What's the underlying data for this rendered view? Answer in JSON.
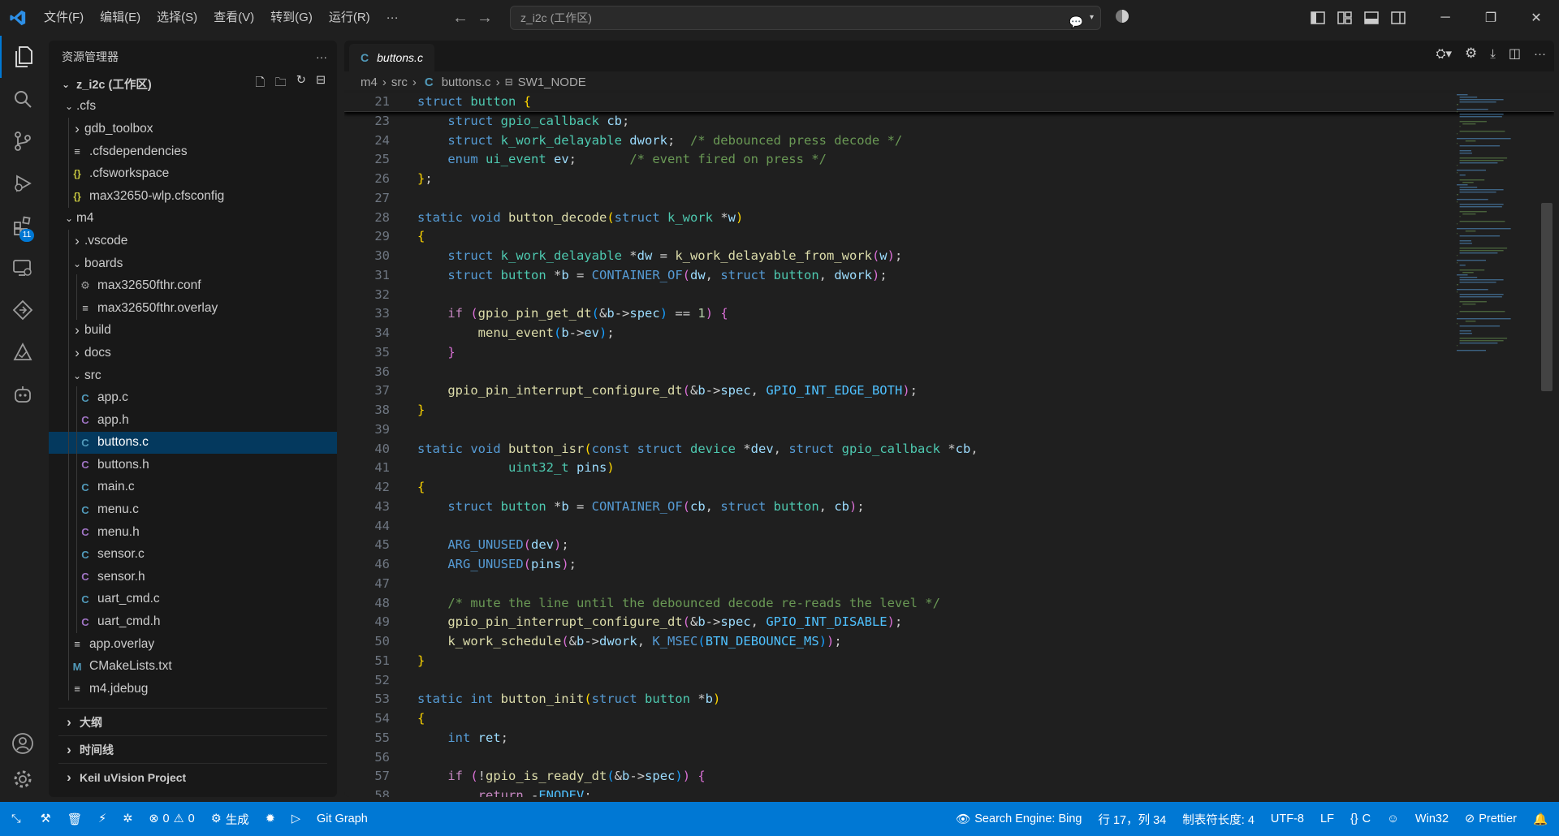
{
  "titlebar": {
    "menus": [
      "文件(F)",
      "编辑(E)",
      "选择(S)",
      "查看(V)",
      "转到(G)",
      "运行(R)",
      "···"
    ],
    "command_center": "z_i2c (工作区)"
  },
  "activity": {
    "extensions_badge": "11"
  },
  "explorer": {
    "title": "资源管理器",
    "more": "···",
    "workspace": "z_i2c (工作区)",
    "rows": [
      {
        "label": ".cfs",
        "depth": 1,
        "chev": "down",
        "icon": ""
      },
      {
        "label": "gdb_toolbox",
        "depth": 2,
        "chev": "right",
        "icon": ""
      },
      {
        "label": ".cfsdependencies",
        "depth": 2,
        "chev": "",
        "icon": "≡"
      },
      {
        "label": ".cfsworkspace",
        "depth": 2,
        "chev": "",
        "icon": "{}"
      },
      {
        "label": "max32650-wlp.cfsconfig",
        "depth": 2,
        "chev": "",
        "icon": "{}"
      },
      {
        "label": "m4",
        "depth": 1,
        "chev": "down",
        "icon": ""
      },
      {
        "label": ".vscode",
        "depth": 2,
        "chev": "right",
        "icon": ""
      },
      {
        "label": "boards",
        "depth": 2,
        "chev": "down",
        "icon": ""
      },
      {
        "label": "max32650fthr.conf",
        "depth": 3,
        "chev": "",
        "icon": "⚙"
      },
      {
        "label": "max32650fthr.overlay",
        "depth": 3,
        "chev": "",
        "icon": "≡"
      },
      {
        "label": "build",
        "depth": 2,
        "chev": "right",
        "icon": ""
      },
      {
        "label": "docs",
        "depth": 2,
        "chev": "right",
        "icon": ""
      },
      {
        "label": "src",
        "depth": 2,
        "chev": "down",
        "icon": ""
      },
      {
        "label": "app.c",
        "depth": 3,
        "chev": "",
        "icon": "C"
      },
      {
        "label": "app.h",
        "depth": 3,
        "chev": "",
        "icon": "C"
      },
      {
        "label": "buttons.c",
        "depth": 3,
        "chev": "",
        "icon": "C"
      },
      {
        "label": "buttons.h",
        "depth": 3,
        "chev": "",
        "icon": "C"
      },
      {
        "label": "main.c",
        "depth": 3,
        "chev": "",
        "icon": "C"
      },
      {
        "label": "menu.c",
        "depth": 3,
        "chev": "",
        "icon": "C"
      },
      {
        "label": "menu.h",
        "depth": 3,
        "chev": "",
        "icon": "C"
      },
      {
        "label": "sensor.c",
        "depth": 3,
        "chev": "",
        "icon": "C"
      },
      {
        "label": "sensor.h",
        "depth": 3,
        "chev": "",
        "icon": "C"
      },
      {
        "label": "uart_cmd.c",
        "depth": 3,
        "chev": "",
        "icon": "C"
      },
      {
        "label": "uart_cmd.h",
        "depth": 3,
        "chev": "",
        "icon": "C"
      },
      {
        "label": "app.overlay",
        "depth": 2,
        "chev": "",
        "icon": "≡"
      },
      {
        "label": "CMakeLists.txt",
        "depth": 2,
        "chev": "",
        "icon": "M"
      },
      {
        "label": "m4.jdebug",
        "depth": 2,
        "chev": "",
        "icon": "≡"
      }
    ],
    "selected": "buttons.c",
    "sections": [
      "大纲",
      "时间线",
      "Keil uVision Project"
    ]
  },
  "editor": {
    "tab": "buttons.c",
    "breadcrumb": [
      "m4",
      "src",
      "buttons.c",
      "SW1_NODE"
    ],
    "lines": [
      {
        "n": "21",
        "sticky": true,
        "t": [
          [
            "kw",
            "struct "
          ],
          [
            "ty",
            "button "
          ],
          [
            "b1",
            "{"
          ]
        ]
      },
      {
        "n": "23",
        "t": [
          [
            "",
            "    "
          ],
          [
            "kw",
            "struct "
          ],
          [
            "ty",
            "gpio_callback "
          ],
          [
            "va",
            "cb"
          ],
          [
            "",
            ";"
          ]
        ]
      },
      {
        "n": "24",
        "t": [
          [
            "",
            "    "
          ],
          [
            "kw",
            "struct "
          ],
          [
            "ty",
            "k_work_delayable "
          ],
          [
            "va",
            "dwork"
          ],
          [
            "",
            ";  "
          ],
          [
            "cm",
            "/* debounced press decode */"
          ]
        ]
      },
      {
        "n": "25",
        "t": [
          [
            "",
            "    "
          ],
          [
            "kw",
            "enum "
          ],
          [
            "ty",
            "ui_event "
          ],
          [
            "va",
            "ev"
          ],
          [
            "",
            ";       "
          ],
          [
            "cm",
            "/* event fired on press */"
          ]
        ]
      },
      {
        "n": "26",
        "t": [
          [
            "b1",
            "}"
          ],
          [
            "",
            ";"
          ]
        ]
      },
      {
        "n": "27",
        "t": []
      },
      {
        "n": "28",
        "t": [
          [
            "kw",
            "static void "
          ],
          [
            "fn",
            "button_decode"
          ],
          [
            "b1",
            "("
          ],
          [
            "kw",
            "struct "
          ],
          [
            "ty",
            "k_work "
          ],
          [
            "",
            "*"
          ],
          [
            "va",
            "w"
          ],
          [
            "b1",
            ")"
          ]
        ]
      },
      {
        "n": "29",
        "t": [
          [
            "b1",
            "{"
          ]
        ]
      },
      {
        "n": "30",
        "t": [
          [
            "",
            "    "
          ],
          [
            "kw",
            "struct "
          ],
          [
            "ty",
            "k_work_delayable "
          ],
          [
            "",
            "*"
          ],
          [
            "va",
            "dw"
          ],
          [
            "",
            " = "
          ],
          [
            "fn",
            "k_work_delayable_from_work"
          ],
          [
            "b2",
            "("
          ],
          [
            "va",
            "w"
          ],
          [
            "b2",
            ")"
          ],
          [
            "",
            ";"
          ]
        ]
      },
      {
        "n": "31",
        "t": [
          [
            "",
            "    "
          ],
          [
            "kw",
            "struct "
          ],
          [
            "ty",
            "button "
          ],
          [
            "",
            "*"
          ],
          [
            "va",
            "b"
          ],
          [
            "",
            " = "
          ],
          [
            "kw",
            "CONTAINER_OF"
          ],
          [
            "b2",
            "("
          ],
          [
            "va",
            "dw"
          ],
          [
            "",
            ", "
          ],
          [
            "kw",
            "struct "
          ],
          [
            "ty",
            "button"
          ],
          [
            "",
            ", "
          ],
          [
            "va",
            "dwork"
          ],
          [
            "b2",
            ")"
          ],
          [
            "",
            ";"
          ]
        ]
      },
      {
        "n": "32",
        "t": []
      },
      {
        "n": "33",
        "t": [
          [
            "",
            "    "
          ],
          [
            "ct",
            "if "
          ],
          [
            "b2",
            "("
          ],
          [
            "fn",
            "gpio_pin_get_dt"
          ],
          [
            "b3",
            "("
          ],
          [
            "",
            "&"
          ],
          [
            "va",
            "b"
          ],
          [
            "",
            "->"
          ],
          [
            "va",
            "spec"
          ],
          [
            "b3",
            ")"
          ],
          [
            "",
            " == "
          ],
          [
            "nm",
            "1"
          ],
          [
            "b2",
            ")"
          ],
          [
            "",
            " "
          ],
          [
            "b2",
            "{"
          ]
        ]
      },
      {
        "n": "34",
        "t": [
          [
            "",
            "        "
          ],
          [
            "fn",
            "menu_event"
          ],
          [
            "b3",
            "("
          ],
          [
            "va",
            "b"
          ],
          [
            "",
            "->"
          ],
          [
            "va",
            "ev"
          ],
          [
            "b3",
            ")"
          ],
          [
            "",
            ";"
          ]
        ]
      },
      {
        "n": "35",
        "t": [
          [
            "",
            "    "
          ],
          [
            "b2",
            "}"
          ]
        ]
      },
      {
        "n": "36",
        "t": []
      },
      {
        "n": "37",
        "t": [
          [
            "",
            "    "
          ],
          [
            "fn",
            "gpio_pin_interrupt_configure_dt"
          ],
          [
            "b2",
            "("
          ],
          [
            "",
            "&"
          ],
          [
            "va",
            "b"
          ],
          [
            "",
            "->"
          ],
          [
            "va",
            "spec"
          ],
          [
            "",
            ", "
          ],
          [
            "mc",
            "GPIO_INT_EDGE_BOTH"
          ],
          [
            "b2",
            ")"
          ],
          [
            "",
            ";"
          ]
        ]
      },
      {
        "n": "38",
        "t": [
          [
            "b1",
            "}"
          ]
        ]
      },
      {
        "n": "39",
        "t": []
      },
      {
        "n": "40",
        "t": [
          [
            "kw",
            "static void "
          ],
          [
            "fn",
            "button_isr"
          ],
          [
            "b1",
            "("
          ],
          [
            "kw",
            "const struct "
          ],
          [
            "ty",
            "device "
          ],
          [
            "",
            "*"
          ],
          [
            "va",
            "dev"
          ],
          [
            "",
            ", "
          ],
          [
            "kw",
            "struct "
          ],
          [
            "ty",
            "gpio_callback "
          ],
          [
            "",
            "*"
          ],
          [
            "va",
            "cb"
          ],
          [
            "",
            ","
          ]
        ]
      },
      {
        "n": "41",
        "t": [
          [
            "",
            "            "
          ],
          [
            "ty",
            "uint32_t "
          ],
          [
            "va",
            "pins"
          ],
          [
            "b1",
            ")"
          ]
        ]
      },
      {
        "n": "42",
        "t": [
          [
            "b1",
            "{"
          ]
        ]
      },
      {
        "n": "43",
        "t": [
          [
            "",
            "    "
          ],
          [
            "kw",
            "struct "
          ],
          [
            "ty",
            "button "
          ],
          [
            "",
            "*"
          ],
          [
            "va",
            "b"
          ],
          [
            "",
            " = "
          ],
          [
            "kw",
            "CONTAINER_OF"
          ],
          [
            "b2",
            "("
          ],
          [
            "va",
            "cb"
          ],
          [
            "",
            ", "
          ],
          [
            "kw",
            "struct "
          ],
          [
            "ty",
            "button"
          ],
          [
            "",
            ", "
          ],
          [
            "va",
            "cb"
          ],
          [
            "b2",
            ")"
          ],
          [
            "",
            ";"
          ]
        ]
      },
      {
        "n": "44",
        "t": []
      },
      {
        "n": "45",
        "t": [
          [
            "",
            "    "
          ],
          [
            "kw",
            "ARG_UNUSED"
          ],
          [
            "b2",
            "("
          ],
          [
            "va",
            "dev"
          ],
          [
            "b2",
            ")"
          ],
          [
            "",
            ";"
          ]
        ]
      },
      {
        "n": "46",
        "t": [
          [
            "",
            "    "
          ],
          [
            "kw",
            "ARG_UNUSED"
          ],
          [
            "b2",
            "("
          ],
          [
            "va",
            "pins"
          ],
          [
            "b2",
            ")"
          ],
          [
            "",
            ";"
          ]
        ]
      },
      {
        "n": "47",
        "t": []
      },
      {
        "n": "48",
        "t": [
          [
            "",
            "    "
          ],
          [
            "cm",
            "/* mute the line until the debounced decode re-reads the level */"
          ]
        ]
      },
      {
        "n": "49",
        "t": [
          [
            "",
            "    "
          ],
          [
            "fn",
            "gpio_pin_interrupt_configure_dt"
          ],
          [
            "b2",
            "("
          ],
          [
            "",
            "&"
          ],
          [
            "va",
            "b"
          ],
          [
            "",
            "->"
          ],
          [
            "va",
            "spec"
          ],
          [
            "",
            ", "
          ],
          [
            "mc",
            "GPIO_INT_DISABLE"
          ],
          [
            "b2",
            ")"
          ],
          [
            "",
            ";"
          ]
        ]
      },
      {
        "n": "50",
        "t": [
          [
            "",
            "    "
          ],
          [
            "fn",
            "k_work_schedule"
          ],
          [
            "b2",
            "("
          ],
          [
            "",
            "&"
          ],
          [
            "va",
            "b"
          ],
          [
            "",
            "->"
          ],
          [
            "va",
            "dwork"
          ],
          [
            "",
            ", "
          ],
          [
            "kw",
            "K_MSEC"
          ],
          [
            "b3",
            "("
          ],
          [
            "mc",
            "BTN_DEBOUNCE_MS"
          ],
          [
            "b3",
            ")"
          ],
          [
            "b2",
            ")"
          ],
          [
            "",
            ";"
          ]
        ]
      },
      {
        "n": "51",
        "t": [
          [
            "b1",
            "}"
          ]
        ]
      },
      {
        "n": "52",
        "t": []
      },
      {
        "n": "53",
        "t": [
          [
            "kw",
            "static int "
          ],
          [
            "fn",
            "button_init"
          ],
          [
            "b1",
            "("
          ],
          [
            "kw",
            "struct "
          ],
          [
            "ty",
            "button "
          ],
          [
            "",
            "*"
          ],
          [
            "va",
            "b"
          ],
          [
            "b1",
            ")"
          ]
        ]
      },
      {
        "n": "54",
        "t": [
          [
            "b1",
            "{"
          ]
        ]
      },
      {
        "n": "55",
        "t": [
          [
            "",
            "    "
          ],
          [
            "kw",
            "int "
          ],
          [
            "va",
            "ret"
          ],
          [
            "",
            ";"
          ]
        ]
      },
      {
        "n": "56",
        "t": []
      },
      {
        "n": "57",
        "t": [
          [
            "",
            "    "
          ],
          [
            "ct",
            "if "
          ],
          [
            "b2",
            "("
          ],
          [
            "",
            "!"
          ],
          [
            "fn",
            "gpio_is_ready_dt"
          ],
          [
            "b3",
            "("
          ],
          [
            "",
            "&"
          ],
          [
            "va",
            "b"
          ],
          [
            "",
            "->"
          ],
          [
            "va",
            "spec"
          ],
          [
            "b3",
            ")"
          ],
          [
            "b2",
            ")"
          ],
          [
            "",
            " "
          ],
          [
            "b2",
            "{"
          ]
        ]
      },
      {
        "n": "58",
        "t": [
          [
            "",
            "        "
          ],
          [
            "ct",
            "return "
          ],
          [
            "",
            "-"
          ],
          [
            "mc",
            "ENODEV"
          ],
          [
            "",
            ";"
          ]
        ]
      }
    ]
  },
  "status": {
    "problems_errors": "0",
    "problems_warnings": "0",
    "build": "生成",
    "git_graph": "Git Graph",
    "search_engine": "Search Engine: Bing",
    "position": "行 17，列 34",
    "indent": "制表符长度: 4",
    "encoding": "UTF-8",
    "eol": "LF",
    "language": "C",
    "platform": "Win32",
    "prettier": "Prettier"
  },
  "colors": {
    "accent": "#0078d4",
    "selection": "#04395e"
  }
}
